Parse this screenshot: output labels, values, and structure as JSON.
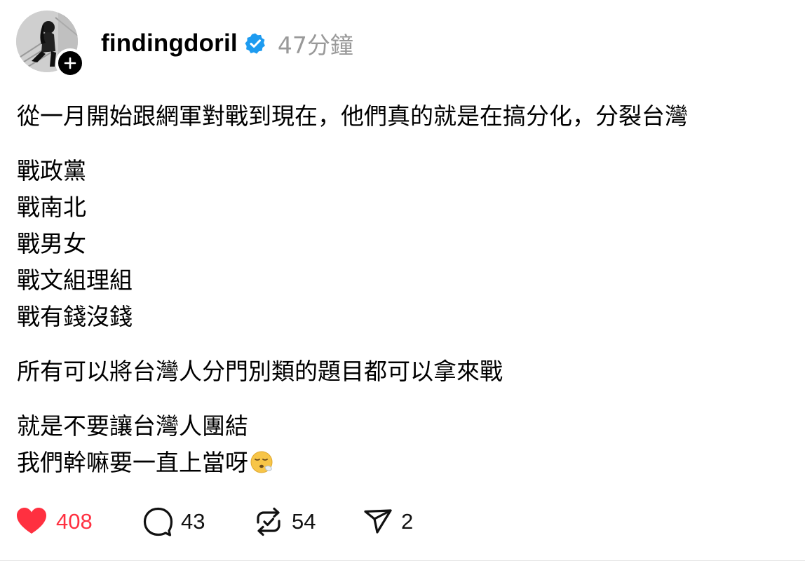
{
  "post": {
    "author": {
      "username": "findingdoril",
      "verified": true,
      "avatar_icon": "profile-photo",
      "follow_icon": "plus-icon"
    },
    "timestamp": "47分鐘",
    "paragraphs": [
      {
        "lines": [
          "從一月開始跟網軍對戰到現在，他們真的就是在搞分化，分裂台灣"
        ]
      },
      {
        "lines": [
          "戰政黨",
          "戰南北",
          "戰男女",
          "戰文組理組",
          "戰有錢沒錢"
        ]
      },
      {
        "lines": [
          "所有可以將台灣人分門別類的題目都可以拿來戰"
        ]
      },
      {
        "lines": [
          "就是不要讓台灣人團結",
          "我們幹嘛要一直上當呀"
        ]
      }
    ],
    "emoji": "face-exhaling",
    "actions": {
      "likes": "408",
      "replies": "43",
      "reposts": "54",
      "shares": "2"
    },
    "colors": {
      "like_accent": "#ff3040",
      "verified_blue": "#1d9bf0",
      "timestamp_gray": "#999999"
    }
  }
}
